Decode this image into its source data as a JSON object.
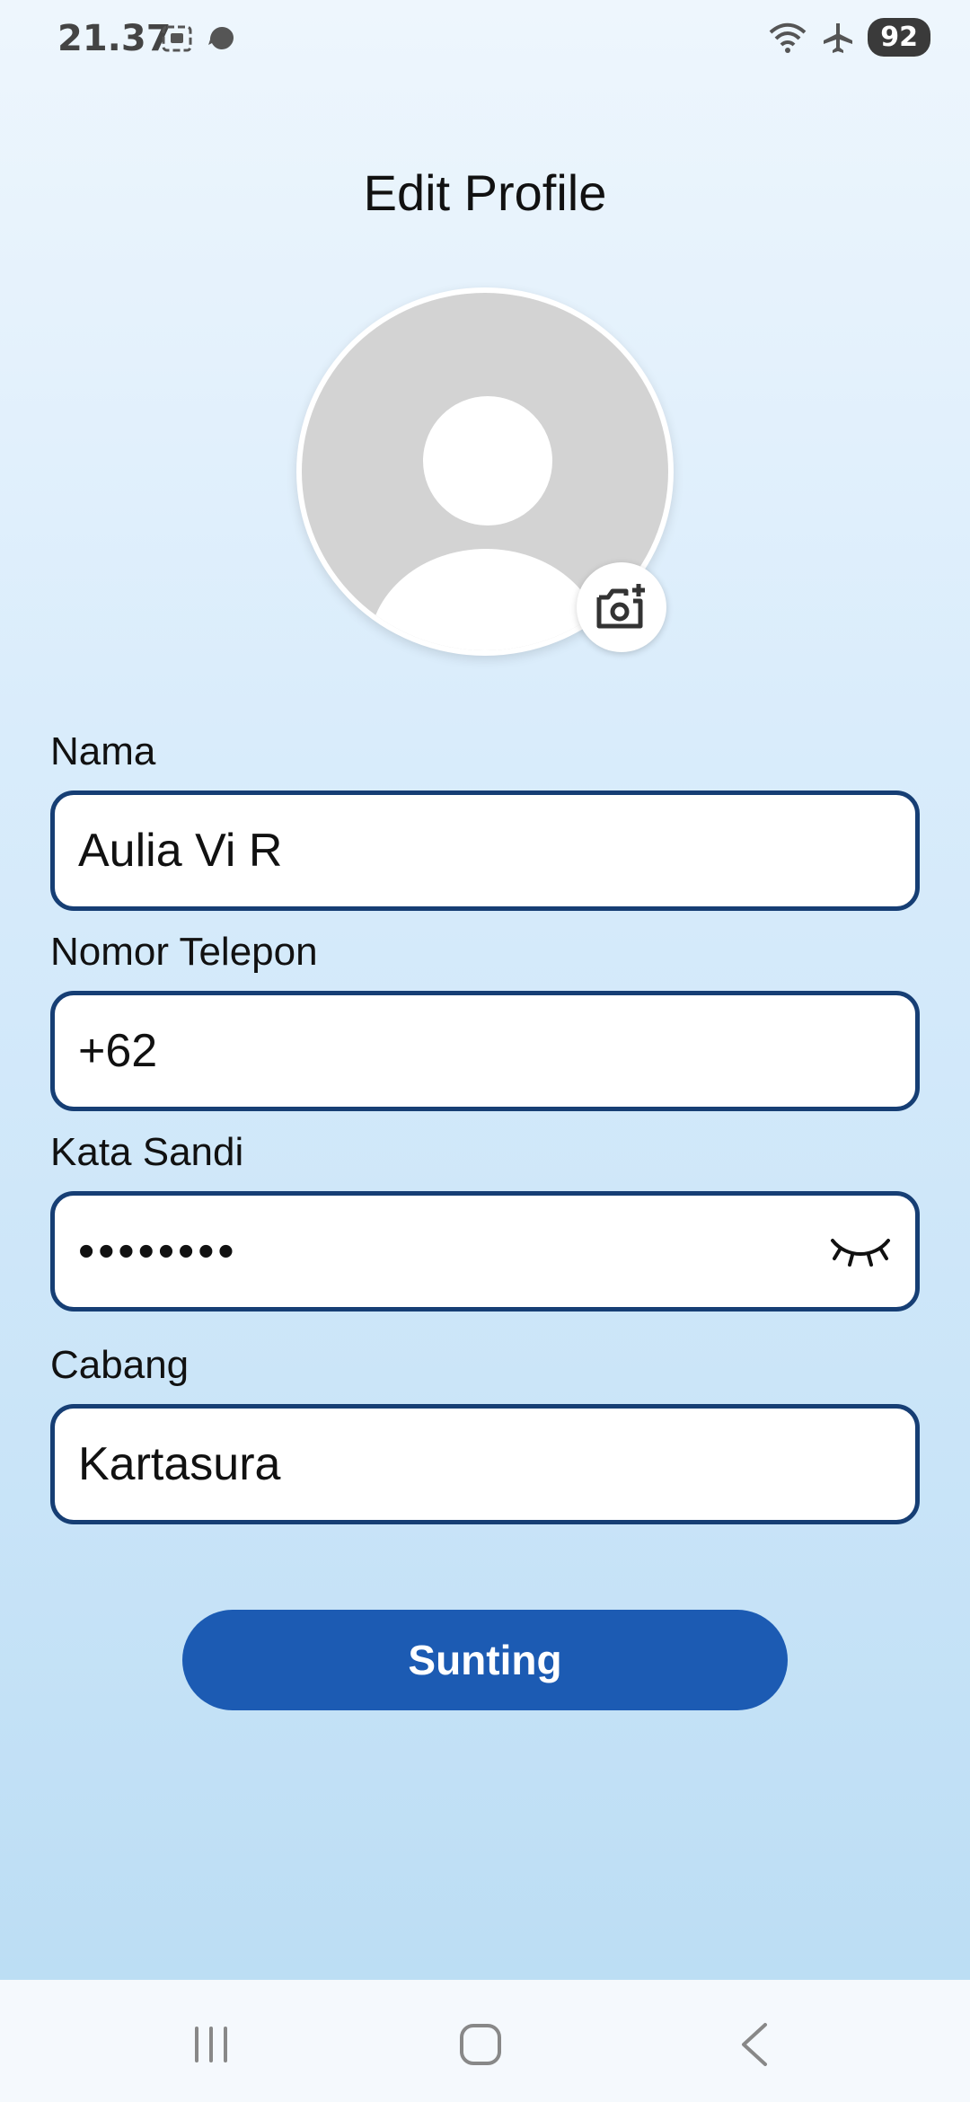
{
  "status_bar": {
    "time": "21.37",
    "battery": "92"
  },
  "title": "Edit Profile",
  "form": {
    "name": {
      "label": "Nama",
      "value": "Aulia Vi R"
    },
    "phone": {
      "label": "Nomor Telepon",
      "value": "+62"
    },
    "password": {
      "label": "Kata Sandi",
      "value": "••••••••"
    },
    "branch": {
      "label": "Cabang",
      "value": "Kartasura"
    }
  },
  "submit_label": "Sunting",
  "icons": {
    "avatar": "default-user-avatar",
    "camera": "camera-add-icon",
    "eye": "eye-closed-icon",
    "nav_recent": "recent-apps-icon",
    "nav_home": "home-icon",
    "nav_back": "back-icon"
  },
  "colors": {
    "accent": "#1c5bb3",
    "field_border": "#163e74"
  }
}
